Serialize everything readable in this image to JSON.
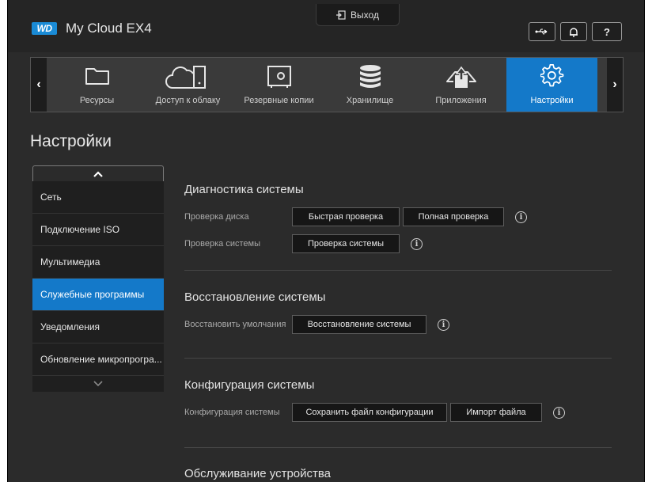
{
  "header": {
    "logo_text": "WD",
    "app_title": "My Cloud EX4",
    "logout_label": "Выход",
    "usb_icon": "usb-icon",
    "bell_icon": "bell-icon",
    "help_label": "?"
  },
  "nav": {
    "items": [
      {
        "label": "Ресурсы",
        "icon": "folder-icon"
      },
      {
        "label": "Доступ к облаку",
        "icon": "cloud-device-icon"
      },
      {
        "label": "Резервные копии",
        "icon": "safe-icon"
      },
      {
        "label": "Хранилище",
        "icon": "database-icon"
      },
      {
        "label": "Приложения",
        "icon": "apps-icon"
      },
      {
        "label": "Настройки",
        "icon": "gear-icon",
        "active": true
      }
    ]
  },
  "page_title": "Настройки",
  "sidebar": {
    "items": [
      {
        "label": "Сеть"
      },
      {
        "label": "Подключение ISO"
      },
      {
        "label": "Мультимедиа"
      },
      {
        "label": "Служебные программы",
        "active": true
      },
      {
        "label": "Уведомления"
      },
      {
        "label": "Обновление микропрогра..."
      }
    ]
  },
  "sections": {
    "diagnostics": {
      "title": "Диагностика системы",
      "disk_label": "Проверка диска",
      "quick_check": "Быстрая проверка",
      "full_check": "Полная проверка",
      "system_label": "Проверка системы",
      "system_check": "Проверка системы"
    },
    "restore": {
      "title": "Восстановление системы",
      "label": "Восстановить умолчания",
      "button": "Восстановление системы"
    },
    "config": {
      "title": "Конфигурация системы",
      "label": "Конфигурация системы",
      "save_button": "Сохранить файл конфигурации",
      "import_button": "Импорт файла"
    },
    "maintenance": {
      "title": "Обслуживание устройства"
    }
  },
  "info_glyph": "i",
  "colors": {
    "accent": "#1479c9",
    "background": "#2b2b2b",
    "topbar": "#252525"
  }
}
